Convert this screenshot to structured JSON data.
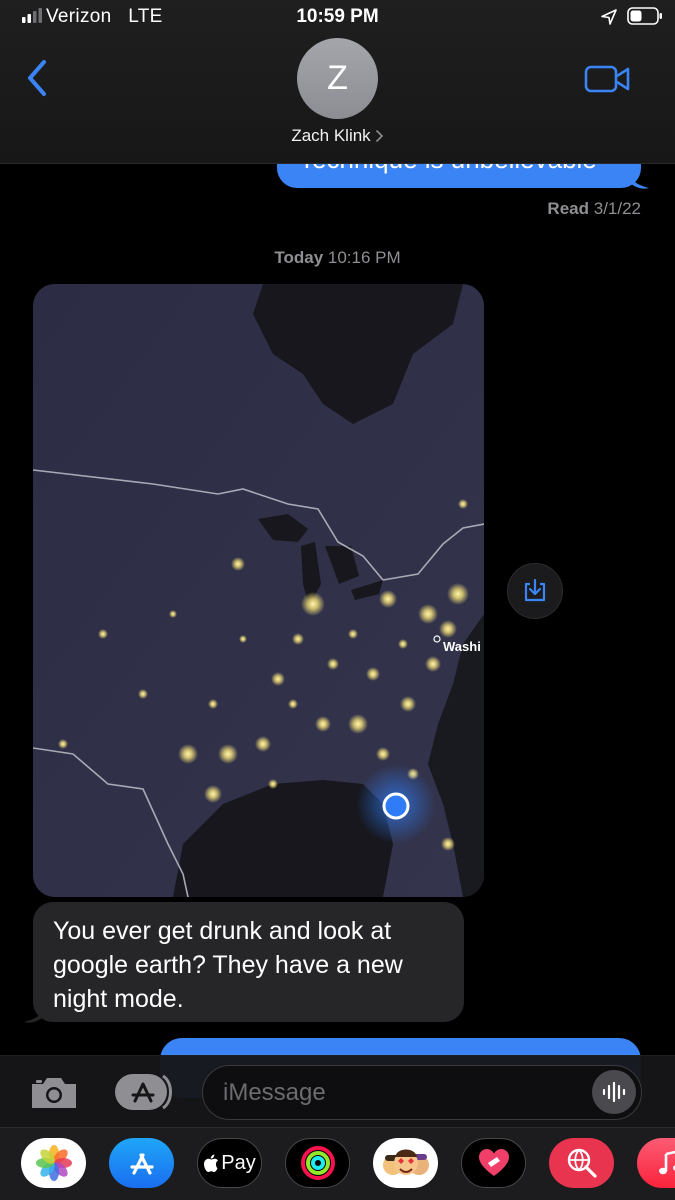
{
  "status_bar": {
    "carrier": "Verizon",
    "network": "LTE",
    "time": "10:59 PM"
  },
  "header": {
    "avatar_initial": "Z",
    "contact_name": "Zach Klink"
  },
  "conversation": {
    "top_sent_partial": "Technique is unbelievable",
    "read_label": "Read",
    "read_date": "3/1/22",
    "timestamp_day": "Today",
    "timestamp_time": "10:16 PM",
    "map_label": "Washi",
    "received_message": "You ever get drunk and look at google earth? They have a new night mode."
  },
  "input_bar": {
    "placeholder": "iMessage"
  },
  "app_drawer": {
    "apple_pay_label": "Pay"
  },
  "colors": {
    "sent_bubble": "#3a84f6",
    "received_bubble": "#262629",
    "accent": "#3a84f6"
  }
}
